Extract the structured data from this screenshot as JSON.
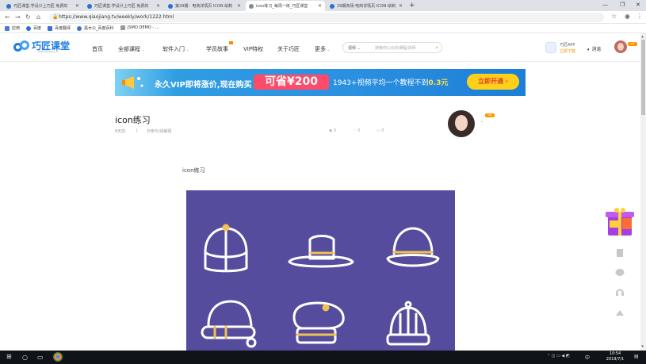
{
  "browser": {
    "tabs": [
      {
        "title": "巧匠课堂-学设计上巧匠 免费的"
      },
      {
        "title": "巧匠课堂-学设计上巧匠 免费的"
      },
      {
        "title": "第29期：电商详情页 ICON 绘制"
      },
      {
        "title": "icon练习_每周一练_巧匠课堂"
      },
      {
        "title": "29期商场-电商详情页 ICON 绘制"
      }
    ],
    "url": "https://www.qiaojiang.tv/weekly/work/1222.html",
    "bookmarks": [
      "应用",
      "百度",
      "百度翻译",
      "黑木公_百度百科",
      "JSMO DEMO - ..."
    ]
  },
  "site": {
    "logo_name": "巧匠课堂",
    "logo_domain": "www.qiaojiang.tv",
    "nav": [
      "首页",
      "全部课程",
      "软件入门",
      "学员故事",
      "VIP特权",
      "关于巧匠",
      "更多"
    ],
    "search_scope": "视频",
    "search_placeholder": "搜索你心仪的课程/讲师",
    "app_title": "巧匠APP",
    "app_sub": "立即下载",
    "messages": "消息",
    "vip": "VIP"
  },
  "banner": {
    "lead": "永久VIP即将涨价,现在购买",
    "big": "可省¥200",
    "rest_a": "1943+视频平均一个教程不到",
    "rest_price": "0.3元",
    "cta": "立即开通 ›"
  },
  "article": {
    "title": "icon练习",
    "time": "8天前",
    "separator": "|",
    "category": "日参与/讲解情",
    "views": "0",
    "likes": "0",
    "comments": "0",
    "caption": "icon练习",
    "author_vip": "VIP",
    "author_dot": "·"
  },
  "taskbar": {
    "time": "10:54",
    "date": "2019/7/1",
    "lang": "中"
  },
  "colors": {
    "brand": "#1d7de0",
    "accent": "#ff8a00",
    "artwork_bg": "#564c9d",
    "stroke": "#ffffff",
    "gold": "#f2c24e"
  }
}
